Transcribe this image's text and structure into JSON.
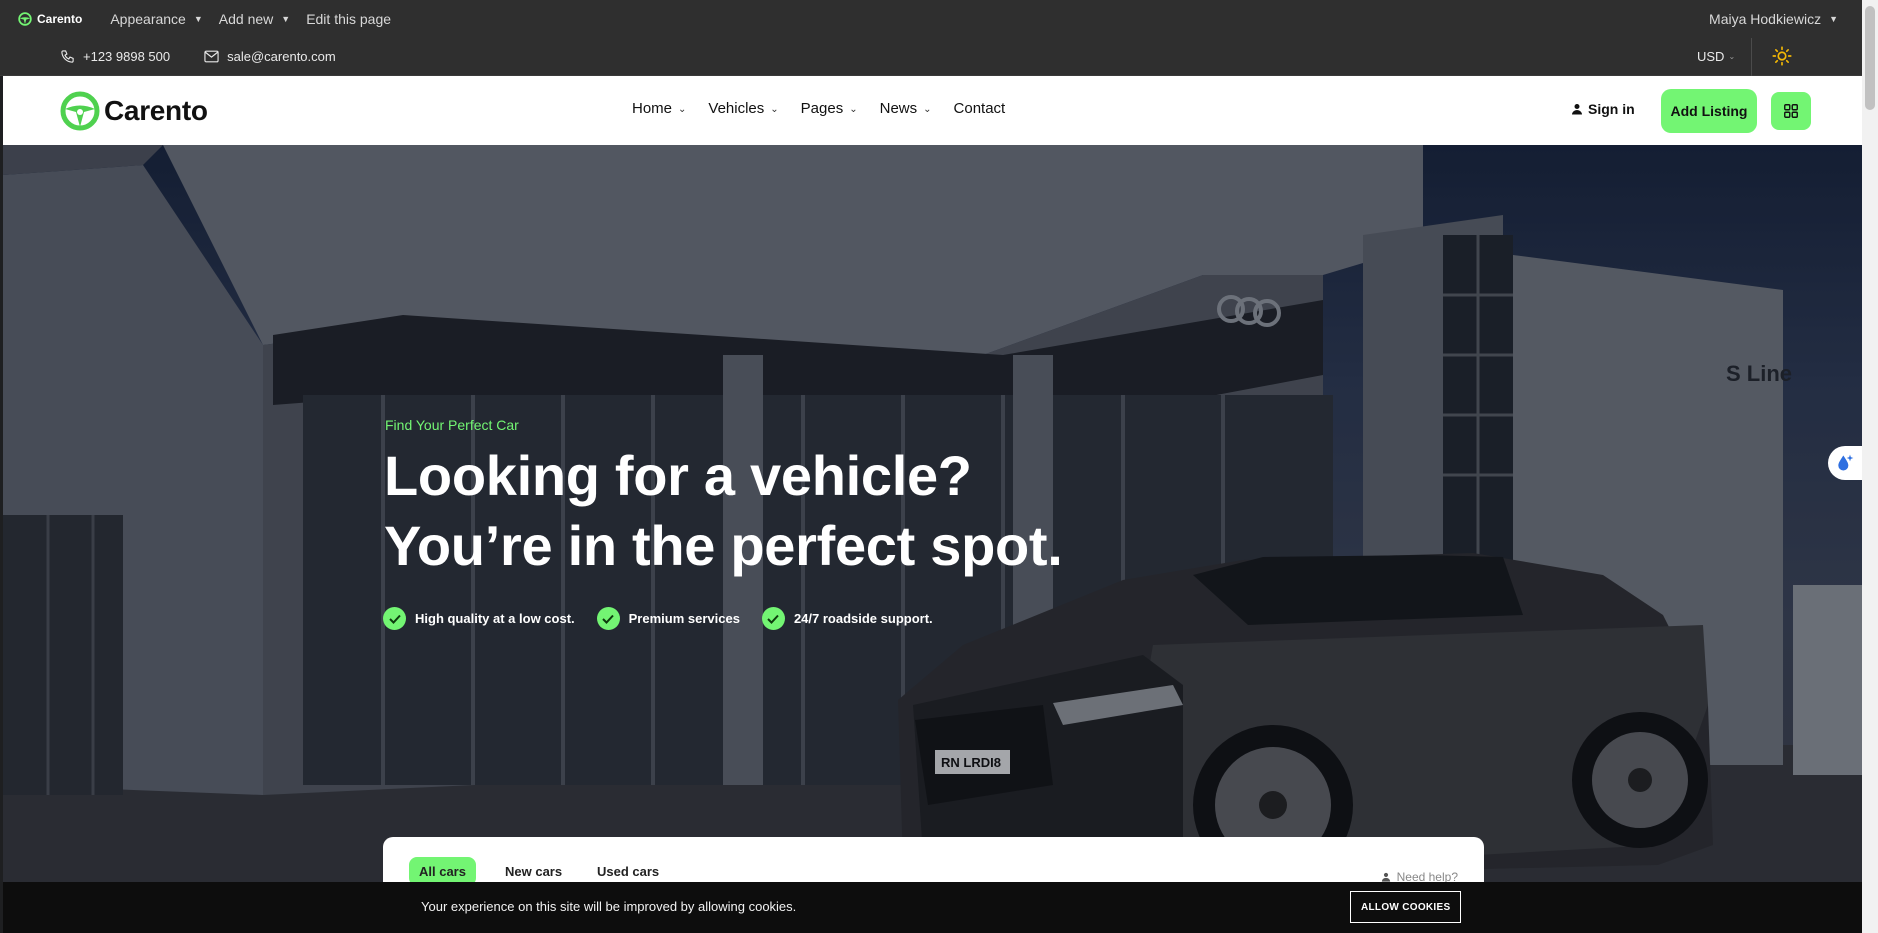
{
  "admin_bar": {
    "site_name": "Carento",
    "menu": [
      "Appearance",
      "Add new",
      "Edit this page"
    ],
    "user": "Maiya Hodkiewicz"
  },
  "contact_bar": {
    "phone": "+123 9898 500",
    "email": "sale@carento.com",
    "currency": "USD"
  },
  "header": {
    "logo_text": "Carento",
    "nav": [
      "Home",
      "Vehicles",
      "Pages",
      "News",
      "Contact"
    ],
    "sign_in": "Sign in",
    "add_listing": "Add Listing"
  },
  "hero": {
    "eyebrow": "Find Your Perfect Car",
    "headline_line1": "Looking for a vehicle?",
    "headline_line2": "You’re in the perfect spot.",
    "features": [
      "High quality at a low cost.",
      "Premium services",
      "24/7 roadside support."
    ],
    "plate_text": "RN LRDI8",
    "sign_text": "S Line"
  },
  "search": {
    "tabs": [
      "All cars",
      "New cars",
      "Used cars"
    ],
    "need_help": "Need help?"
  },
  "cookie": {
    "message": "Your experience on this site will be improved by allowing cookies.",
    "button": "ALLOW COOKIES"
  },
  "colors": {
    "accent": "#73f573",
    "dark_bar": "#2f2f2f",
    "cookie_bar": "#0d0d0d"
  }
}
